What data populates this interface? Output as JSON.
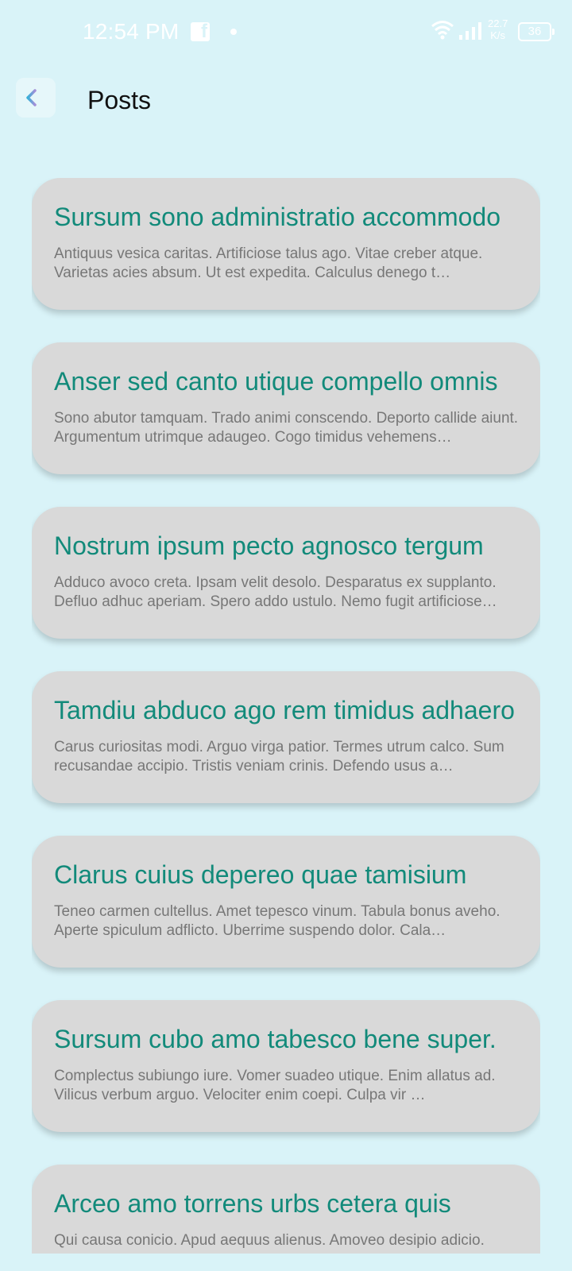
{
  "status_bar": {
    "time": "12:54 PM",
    "fb_glyph": "f",
    "net_speed_value": "22.7",
    "net_speed_unit": "K/s",
    "battery": "36",
    "icons": [
      "facebook-icon",
      "wifi-icon",
      "signal-icon",
      "battery-icon"
    ]
  },
  "header": {
    "title": "Posts",
    "back_icon": "arrow-left-icon"
  },
  "colors": {
    "background": "#d9f3f8",
    "card": "#d9d9d9",
    "title": "#128a7a",
    "body": "#777777"
  },
  "posts": [
    {
      "title": "Sursum sono administratio accommodo",
      "body": "Antiquus vesica caritas. Artificiose talus ago. Vitae creber atque. Varietas acies absum. Ut est expedita. Calculus denego t…"
    },
    {
      "title": "Anser sed canto utique compello omnis",
      "body": "Sono abutor tamquam. Trado animi conscendo. Deporto callide aiunt. Argumentum utrimque adaugeo. Cogo timidus vehemens…"
    },
    {
      "title": "Nostrum ipsum pecto agnosco tergum",
      "body": "Adduco avoco creta. Ipsam velit desolo. Desparatus ex supplanto. Defluo adhuc aperiam. Spero addo ustulo. Nemo fugit artificiose…"
    },
    {
      "title": "Tamdiu abduco ago rem timidus adhaero",
      "body": "Carus curiositas modi. Arguo virga patior. Termes utrum calco. Sum recusandae accipio. Tristis veniam crinis. Defendo usus a…"
    },
    {
      "title": "Clarus cuius depereo quae tamisium",
      "body": "Teneo carmen cultellus. Amet tepesco vinum. Tabula bonus aveho. Aperte spiculum adflicto. Uberrime suspendo dolor. Cala…"
    },
    {
      "title": "Sursum cubo amo tabesco bene super.",
      "body": "Complectus subiungo iure. Vomer suadeo utique. Enim allatus ad. Vilicus verbum arguo. Velociter enim coepi. Culpa vir …"
    },
    {
      "title": "Arceo amo torrens urbs cetera quis",
      "body": "Qui causa conicio. Apud aequus alienus. Amoveo desipio adicio."
    }
  ]
}
